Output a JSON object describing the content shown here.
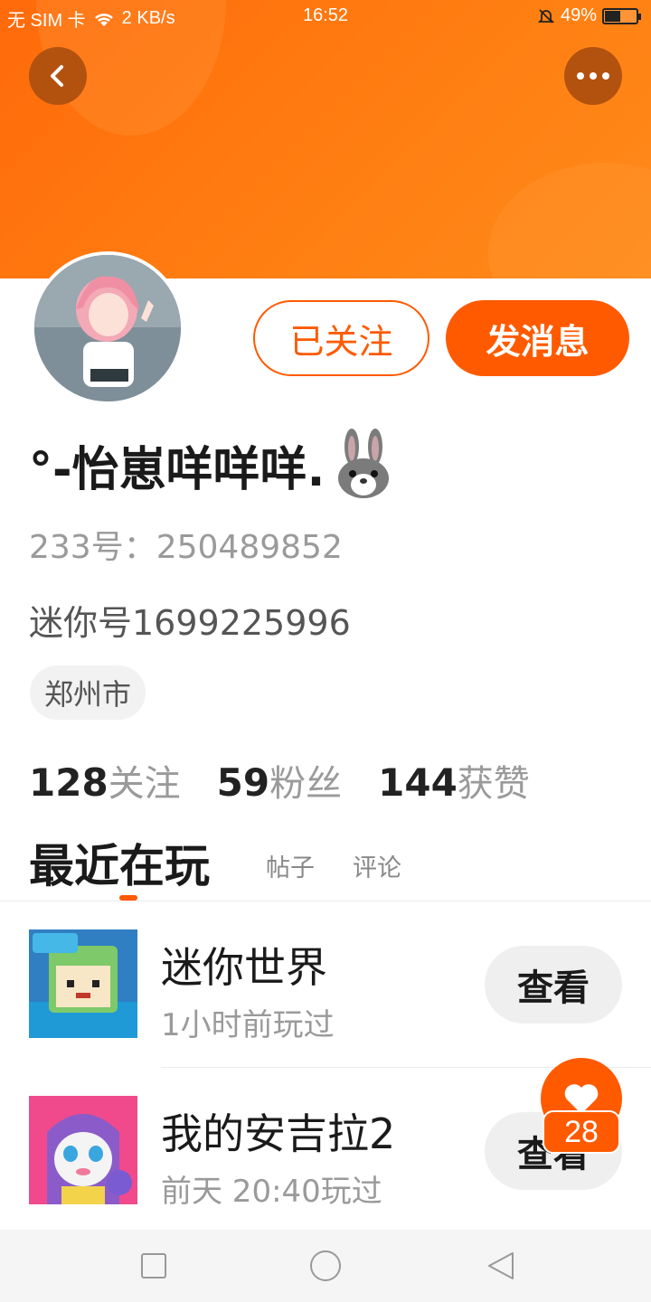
{
  "status_bar": {
    "carrier": "无 SIM 卡",
    "speed": "2 KB/s",
    "time": "16:52",
    "battery": "49%"
  },
  "header": {
    "back_icon": "chevron-left-icon",
    "more_icon": "more-dots-icon",
    "accent_color": "#ff6a0a"
  },
  "profile": {
    "follow_label": "已关注",
    "message_label": "发消息",
    "username": "°-怡崽咩咩咩.",
    "id_233": "233号：250489852",
    "mini_id": "迷你号1699225996",
    "city": "郑州市"
  },
  "stats": [
    {
      "num": "128",
      "label": "关注"
    },
    {
      "num": "59",
      "label": "粉丝"
    },
    {
      "num": "144",
      "label": "获赞"
    }
  ],
  "tabs": {
    "active": "最近在玩",
    "posts": "帖子",
    "comments": "评论"
  },
  "games": [
    {
      "name": "迷你世界",
      "time": "1小时前玩过",
      "view_label": "查看"
    },
    {
      "name": "我的安吉拉2",
      "time": "前天 20:40玩过",
      "view_label": "查看"
    }
  ],
  "like_badge": {
    "count": "28",
    "icon": "heart-icon"
  }
}
